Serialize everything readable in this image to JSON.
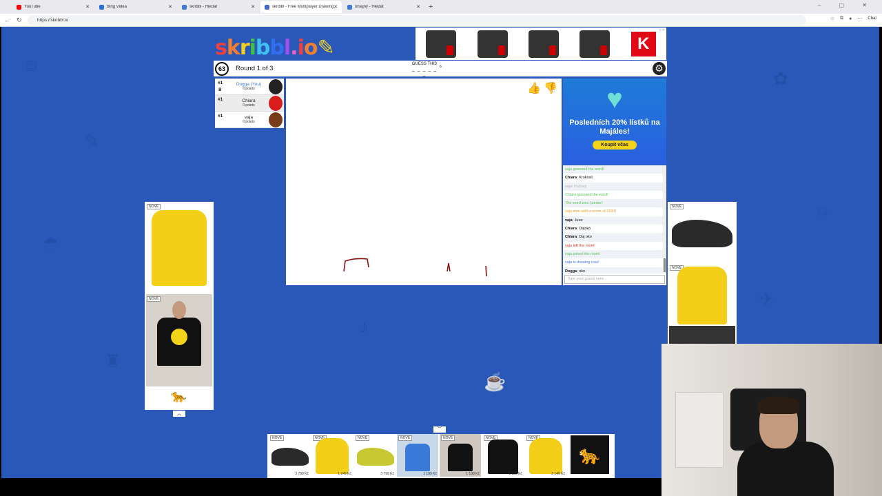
{
  "browser": {
    "tabs": [
      {
        "label": "YouTube",
        "color": "#ff0000",
        "active": false
      },
      {
        "label": "Bing Videa",
        "color": "#2a70d8",
        "active": false
      },
      {
        "label": "skribbl - Hledat",
        "color": "#3a7bd5",
        "active": false
      },
      {
        "label": "skribbl - Free Multiplayer Drawing",
        "color": "#4466cc",
        "active": true
      },
      {
        "label": "onlajny - Hledat",
        "color": "#3a7bd5",
        "active": false
      }
    ],
    "url": "https://skribbl.io",
    "chat_button": "Chat"
  },
  "game": {
    "logo": "skribbl.io",
    "timer": "63",
    "round": "Round 1 of 3",
    "guess_label": "GUESS THIS",
    "word_length": "6",
    "word_blanks": "_ _ _ _ _ _"
  },
  "players": [
    {
      "rank": "#1",
      "name": "Dogga (You)",
      "points": "0 points",
      "you": true,
      "avatar_color": "#222222"
    },
    {
      "rank": "#1",
      "name": "Chiara",
      "points": "0 points",
      "you": false,
      "avatar_color": "#d81d1d"
    },
    {
      "rank": "#1",
      "name": "vaja",
      "points": "0 points",
      "you": false,
      "avatar_color": "#7a3b1a"
    }
  ],
  "chat": {
    "messages": [
      {
        "author": "",
        "text": "vaja guessed the word!",
        "color": "#58c35a",
        "alt": true
      },
      {
        "author": "Chiara",
        "text": "Krokosil",
        "color": "#111111",
        "alt": false
      },
      {
        "author": "",
        "text": "vaja: Pužový",
        "color": "#b0b0b0",
        "alt": true
      },
      {
        "author": "",
        "text": "Chiara guessed the word!",
        "color": "#58c35a",
        "alt": false
      },
      {
        "author": "",
        "text": "The word was 'pardon'",
        "color": "#58c35a",
        "alt": true
      },
      {
        "author": "",
        "text": "vaja won with a score of 1530!",
        "color": "#f0a020",
        "alt": false
      },
      {
        "author": "vaja",
        "text": "Jeee",
        "color": "#111111",
        "alt": true
      },
      {
        "author": "Chiara",
        "text": "Dajoko",
        "color": "#111111",
        "alt": false
      },
      {
        "author": "Chiara",
        "text": "Daj oko",
        "color": "#111111",
        "alt": true
      },
      {
        "author": "",
        "text": "vaja left the room!",
        "color": "#d83a2a",
        "alt": false
      },
      {
        "author": "",
        "text": "vaja joined the room!",
        "color": "#58c35a",
        "alt": true
      },
      {
        "author": "",
        "text": "vaja is drawing now!",
        "color": "#3b78e0",
        "alt": false
      },
      {
        "author": "Dogga",
        "text": "oko",
        "color": "#111111",
        "alt": true
      }
    ],
    "placeholder": "Type your guess here..."
  },
  "side_ad": {
    "title": "Posledních 20% lístků na Majáles!",
    "button": "Koupit včas"
  },
  "ads": {
    "new_badge": "NOVÉ",
    "prices": [
      "3 799 Kč",
      "1 249 Kč",
      "3 799 Kč",
      "1 199 Kč",
      "1 199 Kč",
      "1 329 Kč",
      "2 149 Kč"
    ],
    "kaufland_letter": "K"
  }
}
